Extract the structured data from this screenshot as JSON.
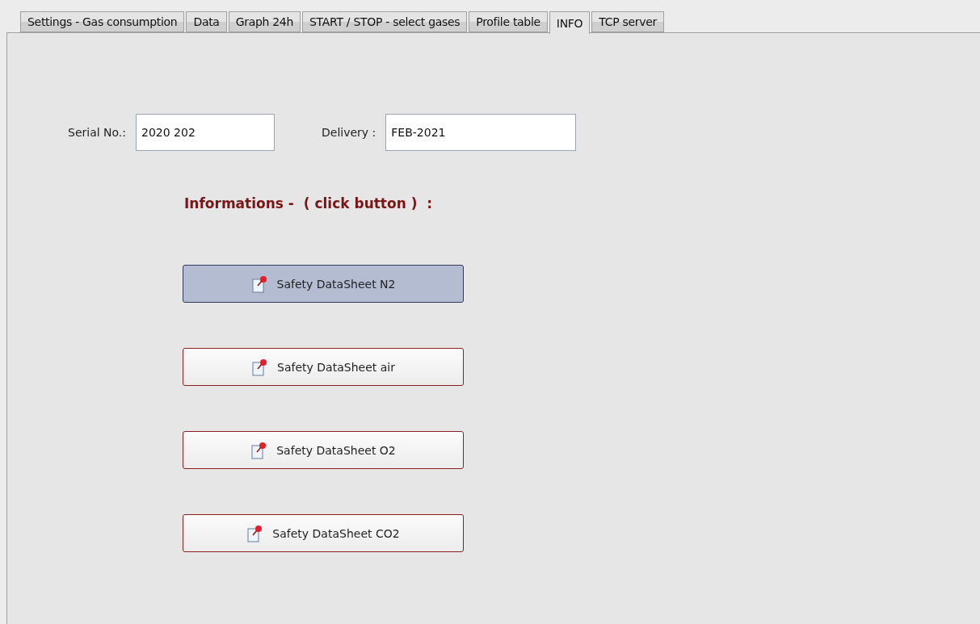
{
  "tabs": [
    {
      "label": "Settings - Gas consumption",
      "selected": false
    },
    {
      "label": "Data",
      "selected": false
    },
    {
      "label": "Graph 24h",
      "selected": false
    },
    {
      "label": "START / STOP  - select gases",
      "selected": false
    },
    {
      "label": "Profile table",
      "selected": false
    },
    {
      "label": "INFO",
      "selected": true
    },
    {
      "label": "TCP server",
      "selected": false
    }
  ],
  "fields": [
    {
      "label": "Serial No.:",
      "value": "2020 202"
    },
    {
      "label": "Delivery :",
      "value": "FEB-2021"
    }
  ],
  "heading": "Informations -  ( click button )  :",
  "buttons": [
    {
      "label": "Safety DataSheet N2",
      "highlighted": true
    },
    {
      "label": "Safety DataSheet air",
      "highlighted": false
    },
    {
      "label": "Safety DataSheet O2",
      "highlighted": false
    },
    {
      "label": "Safety DataSheet CO2",
      "highlighted": false
    }
  ]
}
